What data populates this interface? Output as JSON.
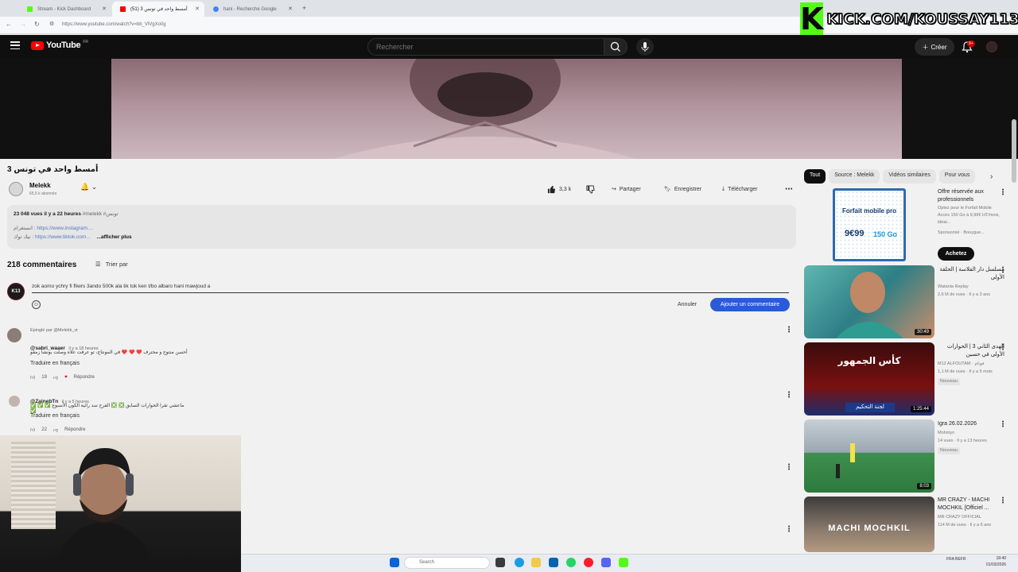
{
  "browser": {
    "tabs": [
      {
        "label": "Stream - Kick Dashboard",
        "color": "#53fc18",
        "active": false
      },
      {
        "label": "أمسط واحد في تونس 3 (51)",
        "color": "#ff0000",
        "active": true
      },
      {
        "label": "hani - Recherche Google",
        "color": "#4285f4",
        "active": false
      }
    ],
    "new_tab": "+",
    "url": "https://www.youtube.com/watch?v=bb_VlVgXo0g"
  },
  "overlay": {
    "kick_logo": "K",
    "kick_text": "KICK.COM/KOUSSAY113"
  },
  "header": {
    "logo": "YouTube",
    "region": "FR",
    "search_placeholder": "Rechercher",
    "create_label": "Créer",
    "notif_badge": "9+"
  },
  "video": {
    "title": "أمسط واحد في تونس 3",
    "channel": "Melekk",
    "subs": "65,5 k abonnés",
    "likes": "3,3 k",
    "share": "Partager",
    "save": "Enregistrer",
    "download": "Télécharger"
  },
  "description": {
    "views": "23 048 vues",
    "time": "il y a 22 heures",
    "tag": "#melekk",
    "tag2": "#تونس",
    "link1_prefix": "انستغرام : ",
    "link1": "https://www.instagram....",
    "link2_prefix": "تيك توك : ",
    "link2": "https://www.tiktok.com...",
    "more": "...afficher plus"
  },
  "comments": {
    "count": "218 commentaires",
    "sort": "Trier par",
    "draft": "zok aomo ychry fi fliwrs 3ando 500k ala tik tok ken t/bo albaro hani mawjoud a",
    "cancel": "Annuler",
    "submit": "Ajouter un commentaire",
    "items": [
      {
        "pinned": "Épinglé par @Melekk_vt",
        "user": "@sabri_waaer",
        "time": "il y a 18 heures",
        "text": "أحسن منتوج و محترف ❤️ ❤️ ❤️ في المونتاج، تو عرفت علاه وصلت بونشا زمقو",
        "translate": "Traduire en français",
        "likes": "19",
        "reply": "Répondre"
      },
      {
        "pinned": "",
        "user": "@ZainebTn",
        "time": "il y a 5 heures",
        "text": "✅ ✅ ✅ ماعشي تقرا الحوارات السابق ❎ ❎ الفرح سد رائية الكون الأسبوع ✅",
        "translate": "Traduire en français",
        "likes": "22",
        "reply": "Répondre"
      }
    ]
  },
  "sidebar": {
    "chips": [
      "Tout",
      "Source : Melekk",
      "Vidéos similaires",
      "Pour vous"
    ],
    "items": [
      {
        "title": "Offre réservée aux professionnels",
        "meta1": "Optez pour le Forfait Mobile Accès 150 Go à 9,99€ HT/mois, idéal...",
        "meta2": "Sponsorisé · Bouygue...",
        "cta": "Achetez",
        "ad_title": "Forfait mobile pro",
        "ad_price": "9€99",
        "ad_data": "150 Go"
      },
      {
        "title": "مسلسل دار الفلاسة | الحلقة الأولى",
        "meta1": "Watania Replay",
        "meta2": "2,6 M de vues · Il y a 3 ans",
        "duration": "30:49"
      },
      {
        "title": "الهدى الثاني 3 | الحوارات الأولى في حسين",
        "meta1": "M12 ALFOUTAM · فوتام",
        "meta2": "1,1 M de vues · Il y a 5 mois",
        "badge": "Nouveau",
        "duration": "1:25:44",
        "thumb_text": "كأس الجمهور",
        "thumb_sub": "لجنة التحكيم"
      },
      {
        "title": "Igra 26.02.2026",
        "meta1": "Mohmyn",
        "meta2": "14 vues · Il y a 13 heures",
        "badge": "Nouveau",
        "duration": "8:03"
      },
      {
        "title": "MR CRAZY - MACHI MOCHKIL [Officiel ...",
        "meta1": "MR CRAZY OFFICIAL",
        "meta2": "114 M de vues · Il y a 6 ans",
        "thumb_text": "MACHI MOCHKIL"
      }
    ]
  },
  "taskbar": {
    "search": "Search",
    "lang": "FRA BEFR",
    "time": "18:40",
    "date": "01/03/2026"
  },
  "colors": {
    "kick_green": "#53fc18",
    "yt_red": "#ff0000",
    "submit_blue": "#2a5bd7"
  }
}
